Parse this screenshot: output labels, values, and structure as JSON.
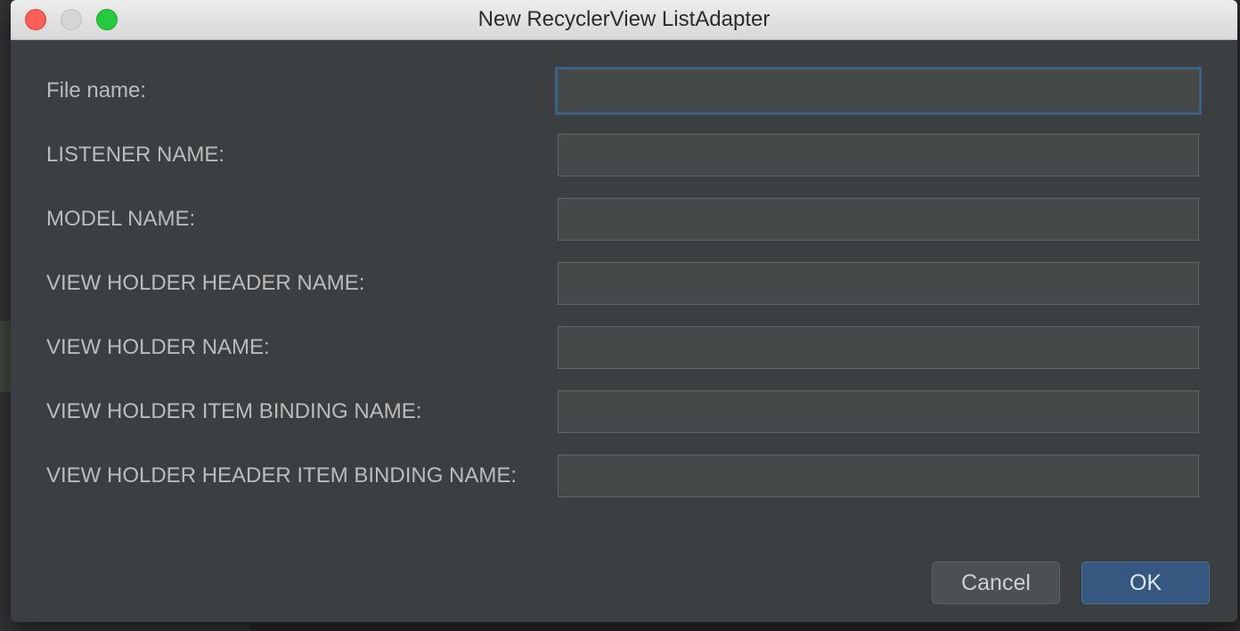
{
  "window": {
    "title": "New RecyclerView ListAdapter"
  },
  "form": {
    "fields": [
      {
        "label": "File name:",
        "value": "",
        "placeholder": ""
      },
      {
        "label": "LISTENER NAME:",
        "value": "",
        "placeholder": ""
      },
      {
        "label": "MODEL NAME:",
        "value": "",
        "placeholder": ""
      },
      {
        "label": "VIEW HOLDER HEADER NAME:",
        "value": "",
        "placeholder": ""
      },
      {
        "label": "VIEW HOLDER NAME:",
        "value": "",
        "placeholder": ""
      },
      {
        "label": "VIEW HOLDER ITEM BINDING NAME:",
        "value": "",
        "placeholder": ""
      },
      {
        "label": "VIEW HOLDER HEADER ITEM BINDING NAME:",
        "value": "",
        "placeholder": ""
      }
    ]
  },
  "buttons": {
    "cancel_label": "Cancel",
    "ok_label": "OK"
  },
  "colors": {
    "dialog_background": "#3c3f41",
    "field_background": "#45494a",
    "focus_ring": "#3d6185",
    "ok_button": "#365880",
    "label_text": "#bbbbbb"
  }
}
